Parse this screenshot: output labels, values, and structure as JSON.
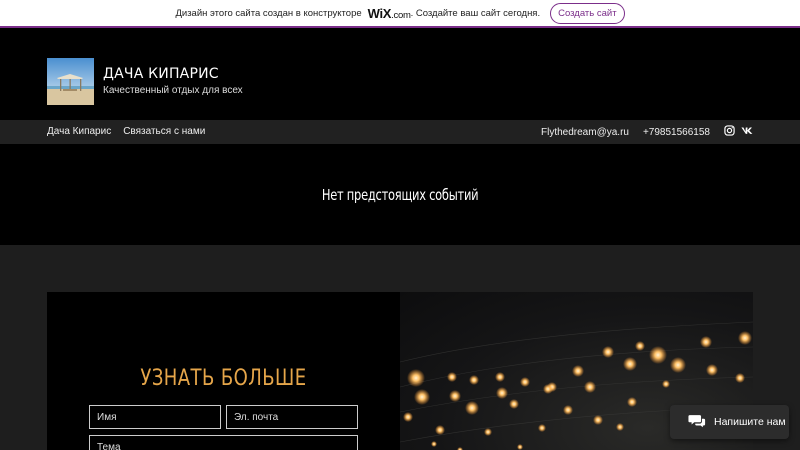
{
  "banner": {
    "text_before": "Дизайн этого сайта создан в конструкторе",
    "wix_logo": "WiX",
    "wix_domain": ".com",
    "text_after": ". Создайте ваш сайт сегодня.",
    "button": "Создать сайт"
  },
  "header": {
    "title": "ДАЧА КИПАРИС",
    "subtitle": "Качественный отдых для всех"
  },
  "nav": {
    "items": [
      "Дача Кипарис",
      "Связаться с нами"
    ],
    "email": "Flythedream@ya.ru",
    "phone": "+79851566158",
    "icons": [
      "instagram-icon",
      "vk-icon"
    ]
  },
  "events": {
    "text": "Нет предстоящих событий"
  },
  "contact": {
    "title": "УЗНАТЬ БОЛЬШЕ",
    "name_placeholder": "Имя",
    "email_placeholder": "Эл. почта",
    "subject_placeholder": "Тема"
  },
  "chat": {
    "label": "Напишите нам"
  },
  "colors": {
    "accent": "#e6a64a",
    "wix_purple": "#7b2e8a",
    "nav_bg": "#212121",
    "lower_bg": "#1e1e1e"
  }
}
